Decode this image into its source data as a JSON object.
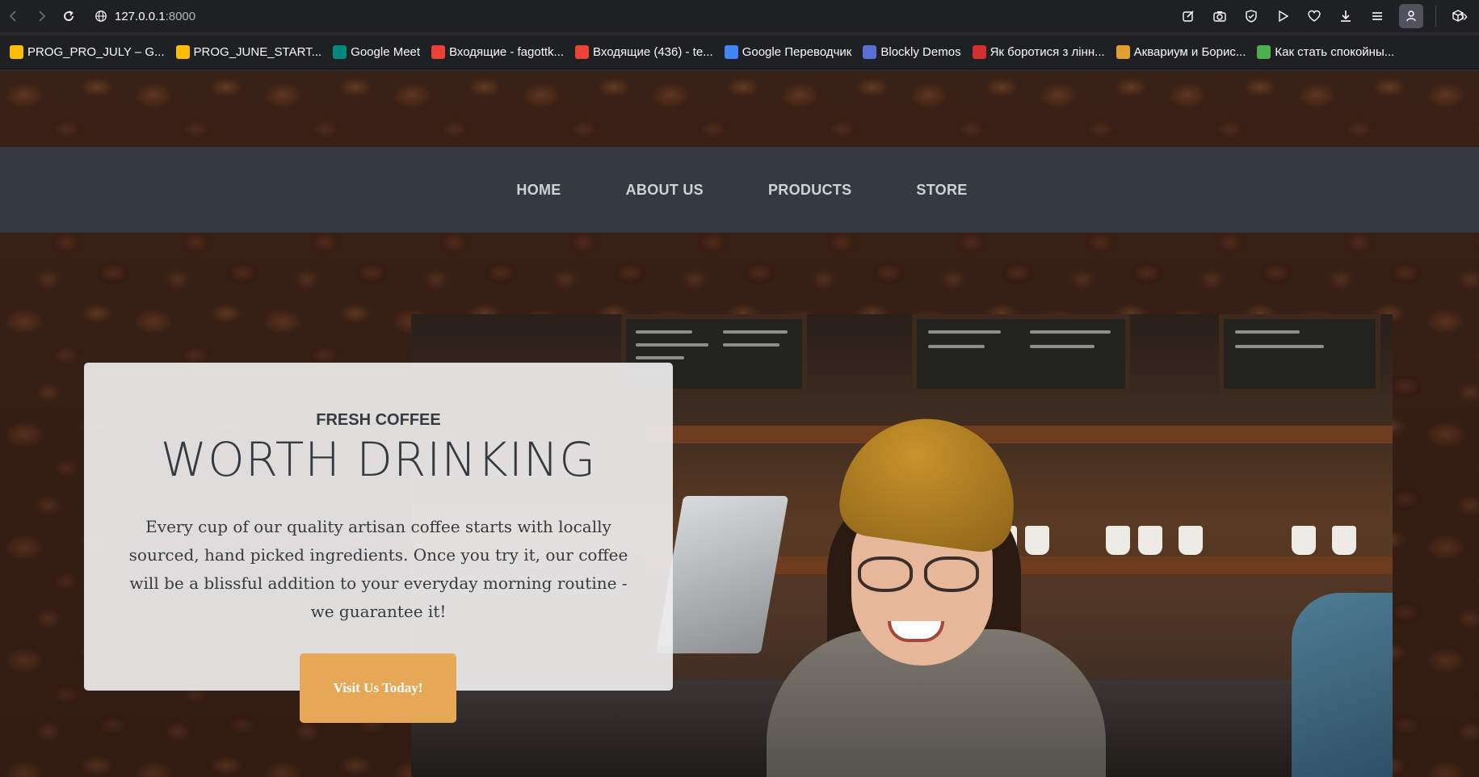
{
  "browser": {
    "url_host": "127.0.0.1",
    "url_port": ":8000",
    "bookmarks": [
      {
        "label": "PROG_PRO_JULY – G...",
        "icon": "google-drive-icon",
        "color": "#fbbc04"
      },
      {
        "label": "PROG_JUNE_START...",
        "icon": "google-drive-icon",
        "color": "#fbbc04"
      },
      {
        "label": "Google Meet",
        "icon": "google-meet-icon",
        "color": "#00897b"
      },
      {
        "label": "Входящие - fagottk...",
        "icon": "gmail-icon",
        "color": "#ea4335"
      },
      {
        "label": "Входящие (436) - te...",
        "icon": "gmail-icon",
        "color": "#ea4335"
      },
      {
        "label": "Google Переводчик",
        "icon": "google-translate-icon",
        "color": "#4285f4"
      },
      {
        "label": "Blockly Demos",
        "icon": "blockly-icon",
        "color": "#5a6fd6"
      },
      {
        "label": "Як боротися з лінн...",
        "icon": "c-logo-icon",
        "color": "#d32f2f"
      },
      {
        "label": "Аквариум и Борис...",
        "icon": "guitar-icon",
        "color": "#e0a030"
      },
      {
        "label": "Как стать спокойны...",
        "icon": "green-circle-icon",
        "color": "#4caf50"
      }
    ]
  },
  "nav": {
    "items": [
      "HOME",
      "ABOUT US",
      "PRODUCTS",
      "STORE"
    ]
  },
  "hero": {
    "kicker": "FRESH COFFEE",
    "headline": "WORTH DRINKING",
    "body": "Every cup of our quality artisan coffee starts with locally sourced, hand picked ingredients. Once you try it, our coffee will be a blissful addition to your everyday morning routine - we guarantee it!",
    "cta_label": "Visit Us Today!"
  },
  "colors": {
    "nav_bg": "#343a40",
    "cta_bg": "#e6a756",
    "card_bg": "#eeeeee"
  }
}
